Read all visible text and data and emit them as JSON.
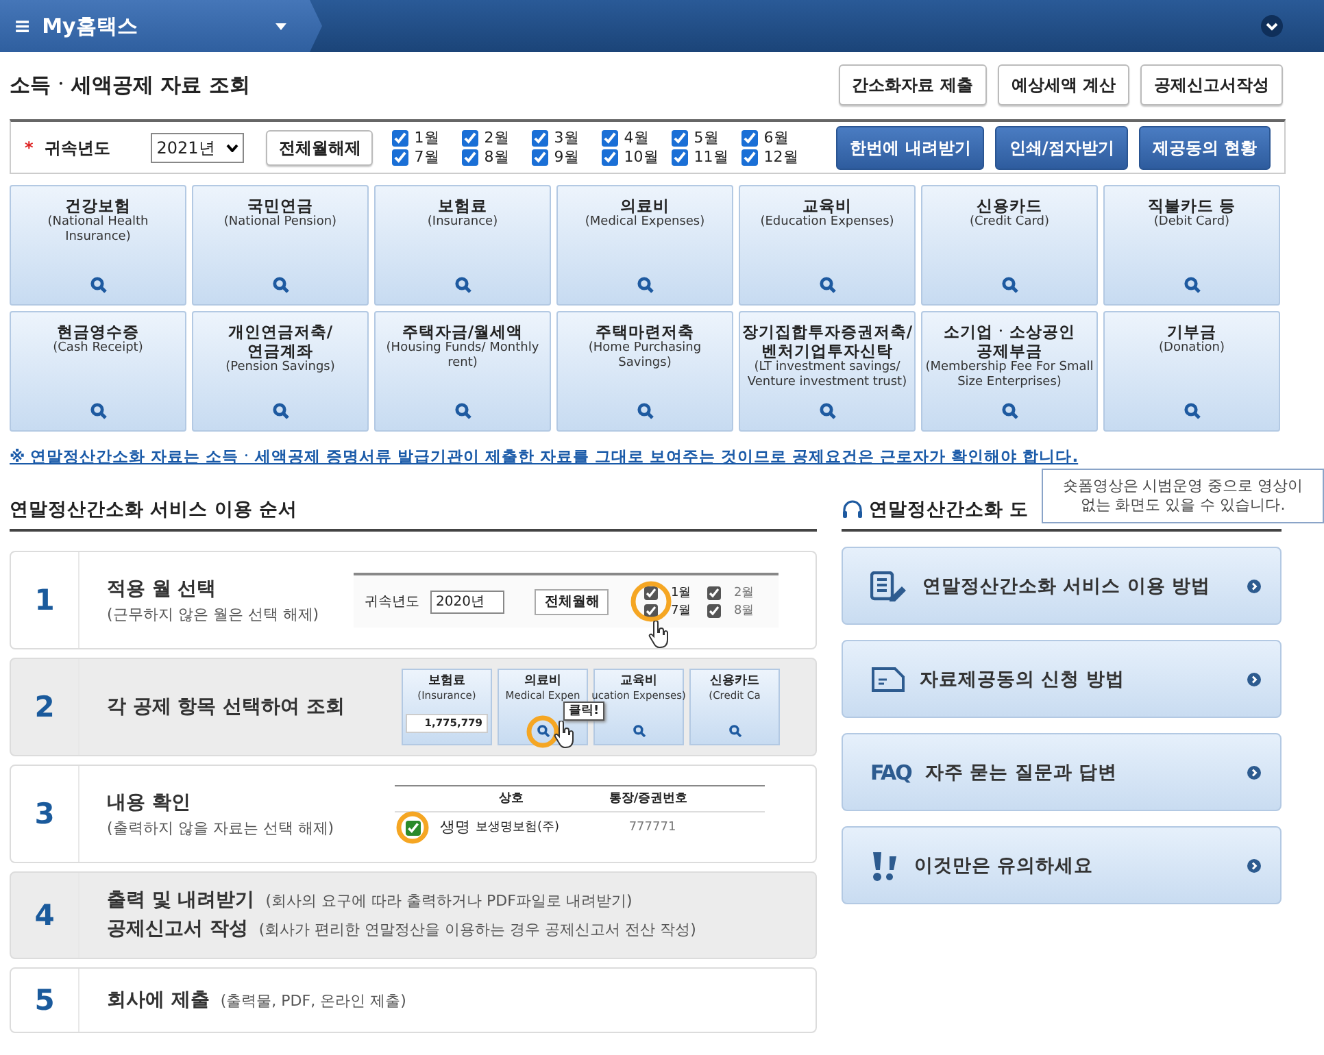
{
  "topbar": {
    "menu_glyph": "≡",
    "title": "My홈택스"
  },
  "page_title": "소득ㆍ세액공제 자료 조회",
  "top_buttons": [
    "간소화자료 제출",
    "예상세액 계산",
    "공제신고서작성"
  ],
  "filter": {
    "required_mark": "*",
    "label": "귀속년도",
    "year": "2021년",
    "clear_button": "전체월해제",
    "months": [
      {
        "label": "1월",
        "checked": true
      },
      {
        "label": "2월",
        "checked": true
      },
      {
        "label": "3월",
        "checked": true
      },
      {
        "label": "4월",
        "checked": true
      },
      {
        "label": "5월",
        "checked": true
      },
      {
        "label": "6월",
        "checked": true
      },
      {
        "label": "7월",
        "checked": true
      },
      {
        "label": "8월",
        "checked": true
      },
      {
        "label": "9월",
        "checked": true
      },
      {
        "label": "10월",
        "checked": true
      },
      {
        "label": "11월",
        "checked": true
      },
      {
        "label": "12월",
        "checked": true
      }
    ],
    "action_buttons": [
      "한번에 내려받기",
      "인쇄/점자받기",
      "제공동의 현황"
    ]
  },
  "tiles": [
    {
      "title": "건강보험",
      "sub": "(National Health Insurance)"
    },
    {
      "title": "국민연금",
      "sub": "(National Pension)"
    },
    {
      "title": "보험료",
      "sub": "(Insurance)"
    },
    {
      "title": "의료비",
      "sub": "(Medical Expenses)"
    },
    {
      "title": "교육비",
      "sub": "(Education Expenses)"
    },
    {
      "title": "신용카드",
      "sub": "(Credit Card)"
    },
    {
      "title": "직불카드 등",
      "sub": "(Debit Card)"
    },
    {
      "title": "현금영수증",
      "sub": "(Cash Receipt)"
    },
    {
      "title": "개인연금저축/ 연금계좌",
      "sub": "(Pension Savings)"
    },
    {
      "title": "주택자금/월세액",
      "sub": "(Housing Funds/ Monthly rent)"
    },
    {
      "title": "주택마련저축",
      "sub": "(Home Purchasing Savings)"
    },
    {
      "title": "장기집합투자증권저축/ 벤처기업투자신탁",
      "sub": "(LT investment savings/ Venture investment trust)"
    },
    {
      "title": "소기업ㆍ소상공인 공제부금",
      "sub": "(Membership Fee For Small Size Enterprises)"
    },
    {
      "title": "기부금",
      "sub": "(Donation)"
    }
  ],
  "notice": "※ 연말정산간소화 자료는 소득ㆍ세액공제 증명서류 발급기관이 제출한 자료를 그대로 보여주는 것이므로 공제요건은 근로자가 확인해야 합니다.",
  "steps_heading": "연말정산간소화 서비스 이용 순서",
  "steps": [
    {
      "number": "1",
      "kind": "stacked",
      "shaded": false,
      "lines": [
        {
          "title": "적용 월 선택",
          "note": "(근무하지 않은 월은 선택 해제)"
        }
      ],
      "illustration": {
        "kind": "year-filter",
        "label": "귀속년도",
        "year": "2020년",
        "button": "전체월해",
        "months": [
          {
            "label": "1월",
            "checked": true
          },
          {
            "label": "7월",
            "checked": true
          },
          {
            "label": "2월",
            "checked": true
          },
          {
            "label": "8월",
            "checked": true
          }
        ]
      }
    },
    {
      "number": "2",
      "kind": "stacked",
      "shaded": true,
      "lines": [
        {
          "title": "각 공제 항목 선택하여 조회"
        }
      ],
      "illustration": {
        "kind": "tiles",
        "callout": "클릭!",
        "tiles": [
          {
            "title": "보험료",
            "sub": "(Insurance)",
            "amount": "1,775,779"
          },
          {
            "title": "의료비",
            "sub": "Medical Expen"
          },
          {
            "title": "교육비",
            "sub": "ucation Expenses)"
          },
          {
            "title": "신용카드",
            "sub": "(Credit Ca"
          }
        ]
      }
    },
    {
      "number": "3",
      "kind": "stacked",
      "shaded": false,
      "lines": [
        {
          "title": "내용 확인",
          "note": "(출력하지 않을 자료는 선택 해제)"
        }
      ],
      "illustration": {
        "kind": "table",
        "columns": [
          "상호",
          "통장/증권번호"
        ],
        "row": {
          "checked": true,
          "name": "생명",
          "company": "보생명보험(주)",
          "number": "777771"
        }
      }
    },
    {
      "number": "4",
      "kind": "inline",
      "shaded": true,
      "lines": [
        {
          "title": "출력 및 내려받기",
          "note": "(회사의 요구에 따라 출력하거나 PDF파일로 내려받기)"
        },
        {
          "title": "공제신고서 작성",
          "note": "(회사가 편리한 연말정산을 이용하는 경우 공제신고서 전산 작성)"
        }
      ]
    },
    {
      "number": "5",
      "kind": "inline",
      "shaded": false,
      "lines": [
        {
          "title": "회사에 제출",
          "note": "(출력물, PDF, 온라인 제출)"
        }
      ]
    }
  ],
  "guide_heading": "연말정산간소화 도",
  "tooltip": "숏폼영상은 시범운영 중으로 영상이 없는 화면도 있을 수 있습니다.",
  "guides": [
    {
      "kind": "pen-doc",
      "label": "연말정산간소화 서비스 이용 방법"
    },
    {
      "kind": "doc",
      "label": "자료제공동의 신청 방법"
    },
    {
      "kind": "faq",
      "prefix": "FAQ",
      "label": "자주 묻는 질문과 답변"
    },
    {
      "kind": "alert",
      "label": "이것만은 유의하세요"
    }
  ]
}
